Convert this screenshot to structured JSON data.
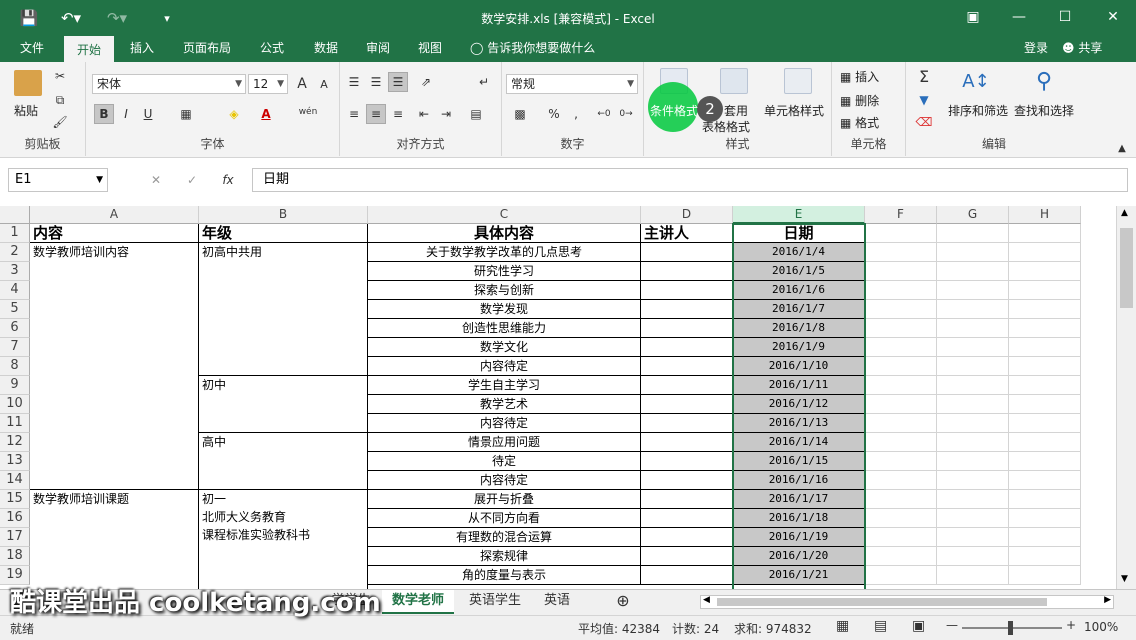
{
  "window": {
    "title": "数学安排.xls  [兼容模式] - Excel"
  },
  "ribbon_tabs": [
    "文件",
    "开始",
    "插入",
    "页面布局",
    "公式",
    "数据",
    "审阅",
    "视图"
  ],
  "tell_me": "告诉我你想要做什么",
  "account": {
    "login": "登录",
    "share": "共享"
  },
  "ribbon": {
    "clipboard": {
      "label": "剪贴板",
      "paste": "粘贴"
    },
    "font": {
      "label": "字体",
      "font_name": "宋体",
      "font_size": "12",
      "bold": "B",
      "italic": "I",
      "underline": "U",
      "grow": "A",
      "shrink": "A",
      "color_letter": "A",
      "wen": "wén"
    },
    "alignment": {
      "label": "对齐方式"
    },
    "number": {
      "label": "数字",
      "format": "常规",
      "percent": "%",
      "comma": ","
    },
    "styles": {
      "label": "样式",
      "conditional": "条件格式",
      "table_format_1": "套用",
      "table_format_2": "表格格式",
      "cell_styles": "单元格样式"
    },
    "cells": {
      "label": "单元格",
      "insert": "插入",
      "delete": "删除",
      "format": "格式"
    },
    "editing": {
      "label": "编辑",
      "sort_filter": "排序和筛选",
      "find_select": "查找和选择"
    }
  },
  "formula_bar": {
    "name_box": "E1",
    "fx": "fx",
    "content": "日期"
  },
  "columns": [
    "A",
    "B",
    "C",
    "D",
    "E",
    "F",
    "G",
    "H"
  ],
  "rows": [
    "1",
    "2",
    "3",
    "4",
    "5",
    "6",
    "7",
    "8",
    "9",
    "10",
    "11",
    "12",
    "13",
    "14",
    "15",
    "16",
    "17",
    "18",
    "19"
  ],
  "headers": {
    "a": "内容",
    "b": "年级",
    "c": "具体内容",
    "d": "主讲人",
    "e": "日期"
  },
  "merged": {
    "a1": "数学教师培训内容",
    "a2": "数学教师培训课题",
    "b1": "初高中共用",
    "b2": "初中",
    "b3": "高中",
    "b4_line1": "初一",
    "b4_line2": "北师大义务教育",
    "b4_line3": "课程标准实验教科书"
  },
  "content_c": [
    "关于数学教学改革的几点思考",
    "研究性学习",
    "探索与创新",
    "数学发现",
    "创造性思维能力",
    "数学文化",
    "内容待定",
    "学生自主学习",
    "教学艺术",
    "内容待定",
    "情景应用问题",
    "待定",
    "内容待定",
    "展开与折叠",
    "从不同方向看",
    "有理数的混合运算",
    "探索规律",
    "角的度量与表示"
  ],
  "dates_e": [
    "2016/1/4",
    "2016/1/5",
    "2016/1/6",
    "2016/1/7",
    "2016/1/8",
    "2016/1/9",
    "2016/1/10",
    "2016/1/11",
    "2016/1/12",
    "2016/1/13",
    "2016/1/14",
    "2016/1/15",
    "2016/1/16",
    "2016/1/17",
    "2016/1/18",
    "2016/1/19",
    "2016/1/20",
    "2016/1/21"
  ],
  "sheets": {
    "partial": "学学生",
    "active": "数学老师",
    "english_student": "英语学生",
    "english": "英语"
  },
  "status": {
    "ready": "就绪",
    "average": "平均值: 42384",
    "count": "计数: 24",
    "sum": "求和: 974832",
    "zoom": "100%"
  },
  "overlay": {
    "watermark": "酷课堂出品 coolketang.com",
    "step": "2"
  }
}
